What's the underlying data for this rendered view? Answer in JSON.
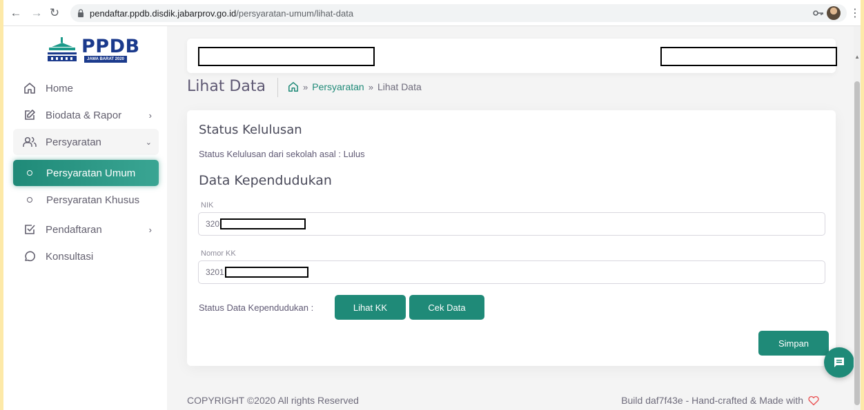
{
  "browser": {
    "url_host": "pendaftar.ppdb.disdik.jabarprov.go.id",
    "url_path": "/persyaratan-umum/lihat-data"
  },
  "logo": {
    "title": "PPDB",
    "badge": "JAWA BARAT 2020"
  },
  "sidebar": {
    "items": [
      {
        "label": "Home",
        "icon": "home-icon"
      },
      {
        "label": "Biodata & Rapor",
        "icon": "edit-icon"
      },
      {
        "label": "Persyaratan",
        "icon": "users-icon"
      },
      {
        "label": "Pendaftaran",
        "icon": "check-square-icon"
      },
      {
        "label": "Konsultasi",
        "icon": "message-circle-icon"
      }
    ],
    "subitems": [
      {
        "label": "Persyaratan Umum",
        "active": true
      },
      {
        "label": "Persyaratan Khusus",
        "active": false
      }
    ]
  },
  "breadcrumb": {
    "title": "Lihat Data",
    "link": "Persyaratan",
    "current": "Lihat Data"
  },
  "card": {
    "status_heading": "Status Kelulusan",
    "status_text": "Status Kelulusan dari sekolah asal : Lulus",
    "data_heading": "Data Kependudukan",
    "nik_label": "NIK",
    "nik_value": "320",
    "kk_label": "Nomor KK",
    "kk_value": "3201",
    "status_data_label": "Status Data Kependudukan :",
    "lihat_kk_button": "Lihat KK",
    "cek_data_button": "Cek Data",
    "simpan_button": "Simpan"
  },
  "footer": {
    "copyright": "COPYRIGHT ©2020 All rights Reserved",
    "build": "Build daf7f43e -  Hand-crafted & Made with"
  },
  "colors": {
    "accent": "#1f8a78",
    "logo_blue": "#1b3a8c",
    "heart": "#ea5455"
  }
}
